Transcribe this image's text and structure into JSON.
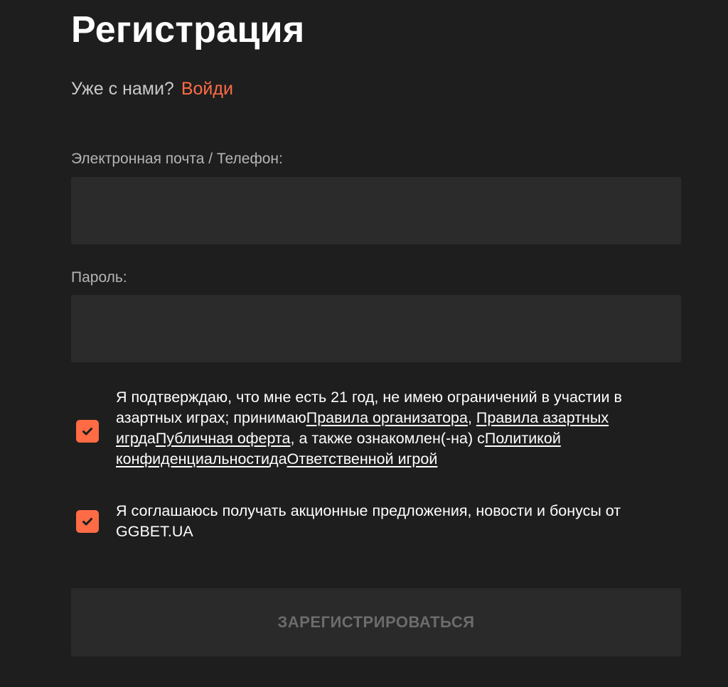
{
  "title": "Регистрация",
  "login_prompt": {
    "text": "Уже с нами?",
    "link": "Войди"
  },
  "email_field": {
    "label": "Электронная почта / Телефон:",
    "value": "",
    "placeholder": ""
  },
  "password_field": {
    "label": "Пароль:",
    "value": "",
    "placeholder": ""
  },
  "terms": {
    "checked": true,
    "text_1": "Я подтверждаю, что мне есть 21 год, не имею ограничений в участии в азартных играх; принимаю",
    "link_organizer_rules": "Правила организатора",
    "sep_1": ", ",
    "link_gambling_rules": "Правила азартных игр",
    "sep_2": "да",
    "link_public_offer": "Публичная оферта",
    "text_2": ", а также ознакомлен(-на) с",
    "link_privacy": "Политикой конфиденциальности",
    "sep_3": "да",
    "link_responsible": "Ответственной игрой"
  },
  "promo": {
    "checked": true,
    "text": "Я соглашаюсь получать акционные предложения, новости и бонусы от GGBET.UA"
  },
  "submit_label": "ЗАРЕГИСТРИРОВАТЬСЯ",
  "colors": {
    "background": "#1e1e1e",
    "input": "#2b2b2b",
    "accent": "#ff6b45",
    "button_disabled": "#2a2a2a",
    "button_text_disabled": "#6c6c6c"
  },
  "icons": {
    "checkbox_checked": "checkmark-icon"
  }
}
